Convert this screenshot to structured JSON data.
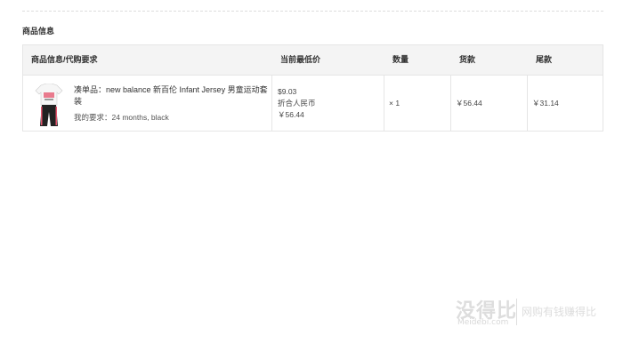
{
  "section": {
    "title": "商品信息"
  },
  "table": {
    "headers": [
      "商品信息/代购要求",
      "当前最低价",
      "数量",
      "货款",
      "尾款"
    ],
    "row": {
      "product_name": "凑单品：new balance 新百伦 Infant Jersey 男童运动套装",
      "requirement": "我的要求：24 months, black",
      "price_usd": "$9.03",
      "price_convert_label": "折合人民币",
      "price_cny": "￥56.44",
      "quantity": "× 1",
      "payment": "￥56.44",
      "balance": "￥31.14"
    }
  },
  "watermark": {
    "main": "没得比",
    "sub": "Meidebi.com",
    "slogan": "网购有钱赚得比"
  },
  "colors": {
    "header_bg": "#f4f4f4",
    "border": "#e5e5e5",
    "text": "#333333"
  }
}
